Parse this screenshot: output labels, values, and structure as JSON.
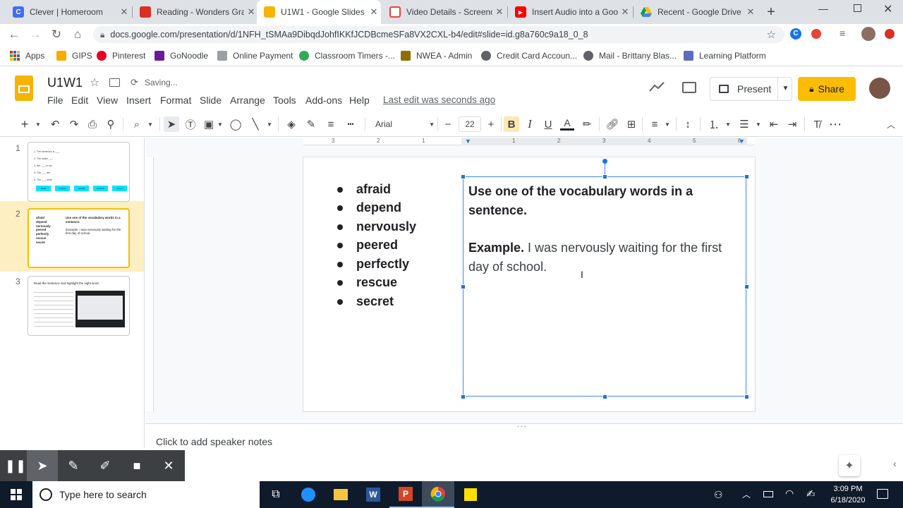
{
  "browser": {
    "tabs": [
      {
        "title": "Clever | Homeroom",
        "icon": "clever-icon",
        "color": "#436cf2",
        "glyph": "C"
      },
      {
        "title": "Reading - Wonders Gra",
        "icon": "wonders-icon",
        "color": "#d93025",
        "glyph": ""
      },
      {
        "title": "U1W1 - Google Slides",
        "icon": "google-slides-icon",
        "color": "#f4b400",
        "glyph": ""
      },
      {
        "title": "Video Details - Screenc",
        "icon": "screencastify-icon",
        "color": "#ea4335",
        "glyph": ""
      },
      {
        "title": "Insert Audio into a Goo",
        "icon": "youtube-icon",
        "color": "#ff0000",
        "glyph": "▶"
      },
      {
        "title": "Recent - Google Drive",
        "icon": "google-drive-icon",
        "color": "#0f9d58",
        "glyph": ""
      }
    ],
    "new_tab_label": "+",
    "url": "docs.google.com/presentation/d/1NFH_tSMAa9DibqdJohfIKKfJCDBcmeSFa8VX2CXL-b4/edit#slide=id.g8a760c9a18_0_8",
    "bookmarks": [
      {
        "label": "Apps",
        "icon": "apps-grid-icon",
        "color": "#5f6368"
      },
      {
        "label": "GIPS",
        "icon": "folder-icon",
        "color": "#f9ab00"
      },
      {
        "label": "Pinterest",
        "icon": "pinterest-icon",
        "color": "#e60023"
      },
      {
        "label": "GoNoodle",
        "icon": "gonoodle-icon",
        "color": "#6a1b9a"
      },
      {
        "label": "Online Payment",
        "icon": "payment-icon",
        "color": "#9aa0a6"
      },
      {
        "label": "Classroom Timers -...",
        "icon": "timer-icon",
        "color": "#34a853"
      },
      {
        "label": "NWEA - Admin",
        "icon": "nwea-icon",
        "color": "#8d6e00"
      },
      {
        "label": "Credit Card Accoun...",
        "icon": "globe-icon",
        "color": "#5f6368"
      },
      {
        "label": "Mail - Brittany Blas...",
        "icon": "globe-icon",
        "color": "#5f6368"
      },
      {
        "label": "Learning Platform",
        "icon": "learning-platform-icon",
        "color": "#5c6bc0"
      }
    ]
  },
  "doc": {
    "title": "U1W1",
    "save_status": "Saving...",
    "menu": [
      "File",
      "Edit",
      "View",
      "Insert",
      "Format",
      "Slide",
      "Arrange",
      "Tools",
      "Add-ons",
      "Help"
    ],
    "last_edit": "Last edit was seconds ago",
    "present_label": "Present",
    "share_label": "Share",
    "accent": "#fbbc04"
  },
  "toolbar": {
    "font": "Arial",
    "font_size": "22",
    "minus": "−",
    "plus": "+"
  },
  "ruler": {
    "labels": [
      "3",
      "2",
      "1",
      "1",
      "2",
      "3",
      "4",
      "5",
      "6"
    ]
  },
  "filmstrip": {
    "slides": [
      {
        "number": "1",
        "lines": [
          "1. The sentence is ___",
          "2. The water ___",
          "3. We ___ in our",
          "4. The ___ the",
          "5. The ___ were"
        ],
        "chips": [
          "afraid",
          "depend",
          "peered",
          "perfectly",
          "rescue"
        ]
      },
      {
        "number": "2",
        "words": [
          "afraid",
          "depend",
          "nervously",
          "peered",
          "perfectly",
          "rescue",
          "secret"
        ],
        "heading": "Use one of the vocabulary words in a sentence.",
        "example": "Example. I was nervously waiting for the first day of school."
      },
      {
        "number": "3",
        "heading": "Read the sentence and highlight the sight word."
      }
    ]
  },
  "slide": {
    "words": [
      "afraid",
      "depend",
      "nervously",
      "peered",
      "perfectly",
      "rescue",
      "secret"
    ],
    "prompt": "Use one of the vocabulary words in a sentence.",
    "example_label": "Example.",
    "example_text": " I was nervously waiting for the first day of school."
  },
  "notes": {
    "placeholder": "Click to add speaker notes"
  },
  "taskbar": {
    "search_placeholder": "Type here to search",
    "time": "3:09 PM",
    "date": "6/18/2020"
  }
}
